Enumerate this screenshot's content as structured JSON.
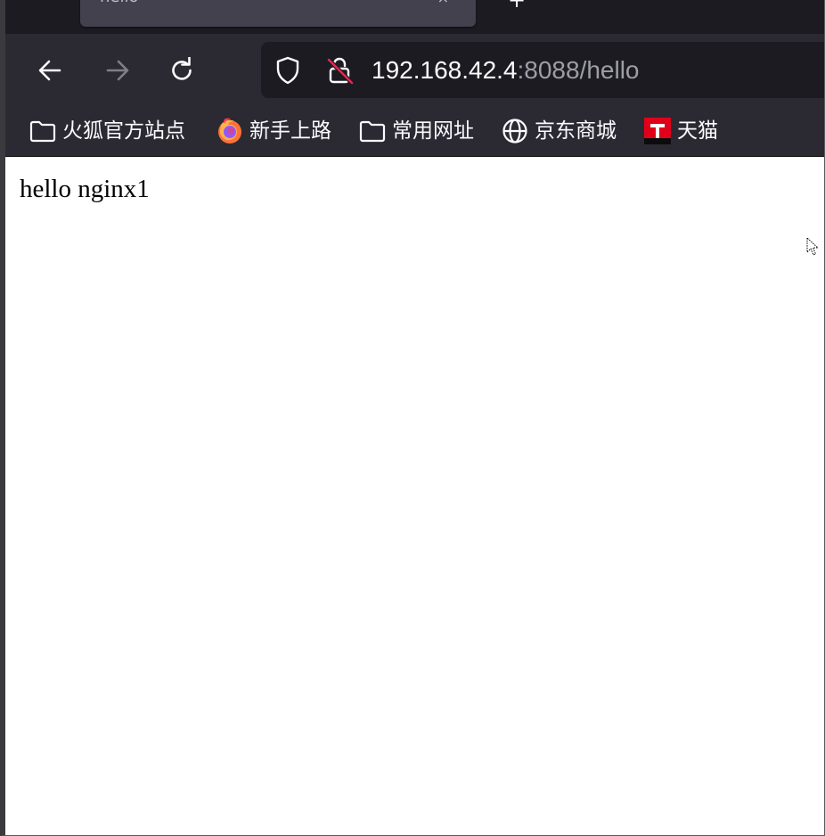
{
  "tab": {
    "title": "hello",
    "close": "×",
    "new_tab": "+"
  },
  "toolbar": {
    "back": "back-arrow-icon",
    "forward": "forward-arrow-icon",
    "reload": "reload-icon"
  },
  "urlbar": {
    "host": "192.168.42.4",
    "rest": ":8088/hello",
    "shield": "tracking-protection-shield-icon",
    "lock": "insecure-lock-icon"
  },
  "bookmarks": [
    {
      "label": "火狐官方站点",
      "icon": "folder-icon"
    },
    {
      "label": "新手上路",
      "icon": "firefox-logo-icon"
    },
    {
      "label": "常用网址",
      "icon": "folder-icon"
    },
    {
      "label": "京东商城",
      "icon": "globe-icon"
    },
    {
      "label": "天猫",
      "icon": "tmall-logo-icon"
    }
  ],
  "page": {
    "body_text": "hello nginx1"
  },
  "colors": {
    "chrome_dark": "#1c1b22",
    "toolbar": "#2b2a33",
    "tab_active": "#42414d",
    "text_light": "#fbfbfe",
    "text_dim": "#9e9ea6",
    "tmall_red": "#e1001a"
  }
}
